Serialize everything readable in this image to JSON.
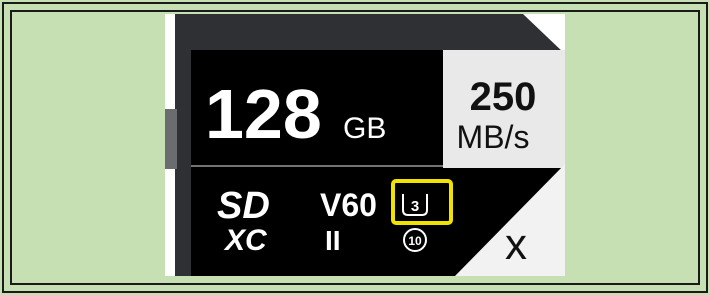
{
  "card": {
    "capacity_number": "128",
    "capacity_unit": "GB",
    "speed_number": "250",
    "speed_unit": "MB/s",
    "logo_sd": "SD",
    "logo_xc": "XC",
    "video_class": "V60",
    "bus_class": "II",
    "uhs_speed_class": "3",
    "speed_class": "10",
    "partial_text": "x"
  },
  "highlight": {
    "color": "#f2e200",
    "target": "UHS speed class 3 symbol"
  },
  "colors": {
    "background": "#c6e0b4",
    "card_body": "#2f3033",
    "label_black": "#000000",
    "label_white": "#ffffff",
    "side_panel": "#e8e8e8"
  }
}
